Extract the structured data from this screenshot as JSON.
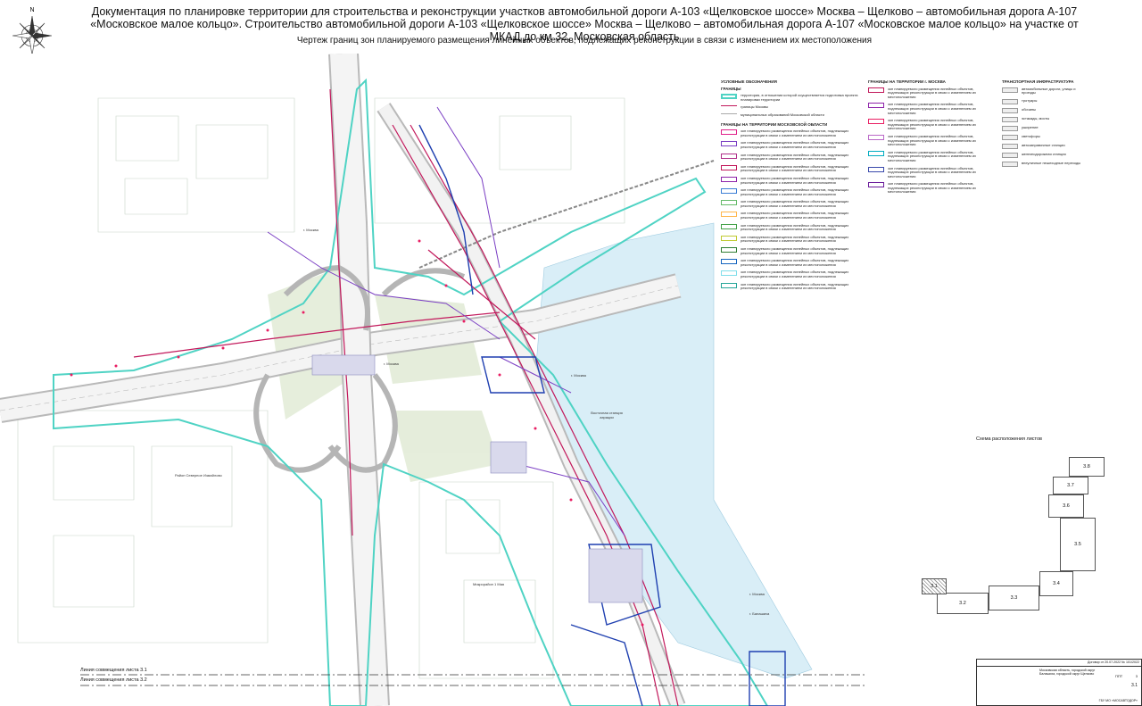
{
  "header": {
    "title": "Документация по планировке территории для строительства и реконструкции участков автомобильной дороги А-103 «Щелковское шоссе» Москва – Щелково – автомобильная дорога А-107 «Московское малое кольцо». Строительство автомобильной дороги А-103 «Щелковское шоссе» Москва – Щелково – автомобильная дорога  А-107 «Московское малое кольцо» на участке от МКАД до км 32, Московская область",
    "subtitle": "Чертеж границ зон планируемого размещения линейных объектов, подлежащих реконструкции в связи с изменением их местоположения"
  },
  "compass": {
    "north_letter": "N"
  },
  "map": {
    "labels": {
      "moscow_1": "г. Москва",
      "moscow_2": "г. Москва",
      "moscow_3": "г. Москва",
      "moscow_4": "г. Москва",
      "balashikha": "г. Балашиха",
      "district": "Район Северное Измайлово",
      "microdistrict": "Микрорайон 1 Мая",
      "lake": "Восточная станция аэрации"
    }
  },
  "legend": {
    "title": "УСЛОВНЫЕ ОБОЗНАЧЕНИЯ",
    "col1_heading": "ГРАНИЦЫ",
    "col1_items": [
      "территория, в отношении которой осуществляется подготовка проекта планировки территории",
      "границы Москвы",
      "муниципальных образований Московской области"
    ],
    "mo_heading": "ГРАНИЦЫ НА ТЕРРИТОРИИ МОСКОВСКОЙ ОБЛАСТИ",
    "mo_items": [
      "зон планируемого размещения линейных объектов, подлежащих реконструкции в связи с изменением их местоположения",
      "зон планируемого размещения линейных объектов, подлежащих реконструкции в связи с изменением их местоположения",
      "зон планируемого размещения линейных объектов, подлежащих реконструкции в связи с изменением их местоположения",
      "зон планируемого размещения линейных объектов, подлежащих реконструкции в связи с изменением их местоположения",
      "зон планируемого размещения линейных объектов, подлежащих реконструкции в связи с изменением их местоположения",
      "зон планируемого размещения линейных объектов, подлежащих реконструкции в связи с изменением их местоположения",
      "зон планируемого размещения линейных объектов, подлежащих реконструкции в связи с изменением их местоположения",
      "зон планируемого размещения линейных объектов, подлежащих реконструкции в связи с изменением их местоположения",
      "зон планируемого размещения линейных объектов, подлежащих реконструкции в связи с изменением их местоположения",
      "зон планируемого размещения линейных объектов, подлежащих реконструкции в связи с изменением их местоположения",
      "зон планируемого размещения линейных объектов, подлежащих реконструкции в связи с изменением их местоположения",
      "зон планируемого размещения линейных объектов, подлежащих реконструкции в связи с изменением их местоположения",
      "зон планируемого размещения линейных объектов, подлежащих реконструкции в связи с изменением их местоположения",
      "зон планируемого размещения линейных объектов, подлежащих реконструкции в связи с изменением их местоположения"
    ],
    "mo_colors": [
      "#e0218a",
      "#7b3fc4",
      "#b0308a",
      "#c2185b",
      "#8e24aa",
      "#3c7fd6",
      "#66bb6a",
      "#ffb74d",
      "#43a047",
      "#c0ca33",
      "#2e7d32",
      "#1565c0",
      "#80deea",
      "#26a69a"
    ],
    "msk_heading": "ГРАНИЦЫ НА ТЕРРИТОРИИ г. МОСКВА",
    "msk_items": [
      "зон планируемого размещения линейных объектов, подлежащих реконструкции в связи с изменением их местоположения",
      "зон планируемого размещения линейных объектов, подлежащих реконструкции в связи с изменением их местоположения",
      "зон планируемого размещения линейных объектов, подлежащих реконструкции в связи с изменением их местоположения",
      "зон планируемого размещения линейных объектов, подлежащих реконструкции в связи с изменением их местоположения",
      "зон планируемого размещения линейных объектов, подлежащих реконструкции в связи с изменением их местоположения",
      "зон планируемого размещения линейных объектов, подлежащих реконструкции в связи с изменением их местоположения",
      "зон планируемого размещения линейных объектов, подлежащих реконструкции в связи с изменением их местоположения"
    ],
    "msk_colors": [
      "#c2185b",
      "#8e24aa",
      "#e91e63",
      "#ba68c8",
      "#00acc1",
      "#3949ab",
      "#6a1b9a"
    ],
    "transport_heading": "ТРАНСПОРТНАЯ ИНФРАСТРУКТУРА",
    "transport_items": [
      "автомобильные дороги, улицы и проезды",
      "тротуары",
      "обочины",
      "эстакады, мосты",
      "уширение",
      "светофоры",
      "автозаправочные станции",
      "железнодорожная станция",
      "внеуличные пешеходные переходы"
    ]
  },
  "scheme": {
    "title": "Схема расположения листов",
    "cells": [
      "3.8",
      "3.7",
      "3.6",
      "3.5",
      "3.4",
      "3.3",
      "3.2",
      "3.1"
    ]
  },
  "combine_lines": [
    "Линия совмещения листа  3.1",
    "Линия совмещения листа  3.2"
  ],
  "stamp": {
    "contract": "Договор от 20.07.2022 № 101/2022",
    "location": "Московская область, городской округ Балашиха, городской округ Щелково",
    "stage": "ППТ",
    "sheet": "3.1",
    "sheets": "3",
    "org": "ГБУ МО «МОСАВТОДОР»"
  }
}
